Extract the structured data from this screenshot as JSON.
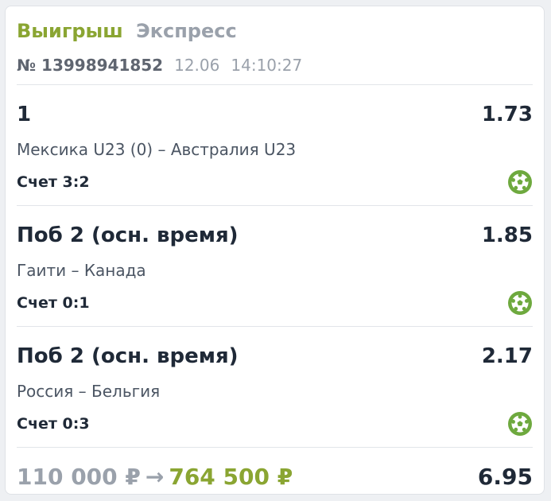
{
  "header": {
    "status": "Выигрыш",
    "bet_type": "Экспресс",
    "number": "№ 13998941852",
    "date": "12.06",
    "time": "14:10:27"
  },
  "bets": [
    {
      "outcome": "1",
      "odd": "1.73",
      "match": "Мексика U23 (0) – Австралия U23",
      "score": "Счет 3:2",
      "icon": "soccer-ball-icon"
    },
    {
      "outcome": "Поб 2 (осн. время)",
      "odd": "1.85",
      "match": "Гаити – Канада",
      "score": "Счет 0:1",
      "icon": "soccer-ball-icon"
    },
    {
      "outcome": "Поб 2 (осн. время)",
      "odd": "2.17",
      "match": "Россия – Бельгия",
      "score": "Счет 0:3",
      "icon": "soccer-ball-icon"
    }
  ],
  "footer": {
    "stake": "110 000 ₽",
    "arrow": "→",
    "payout": "764 500 ₽",
    "total_odd": "6.95"
  },
  "colors": {
    "win_green": "#8aa532",
    "icon_green": "#6ea93e",
    "muted_gray": "#9aa1ab",
    "text_dark": "#1f2937"
  }
}
